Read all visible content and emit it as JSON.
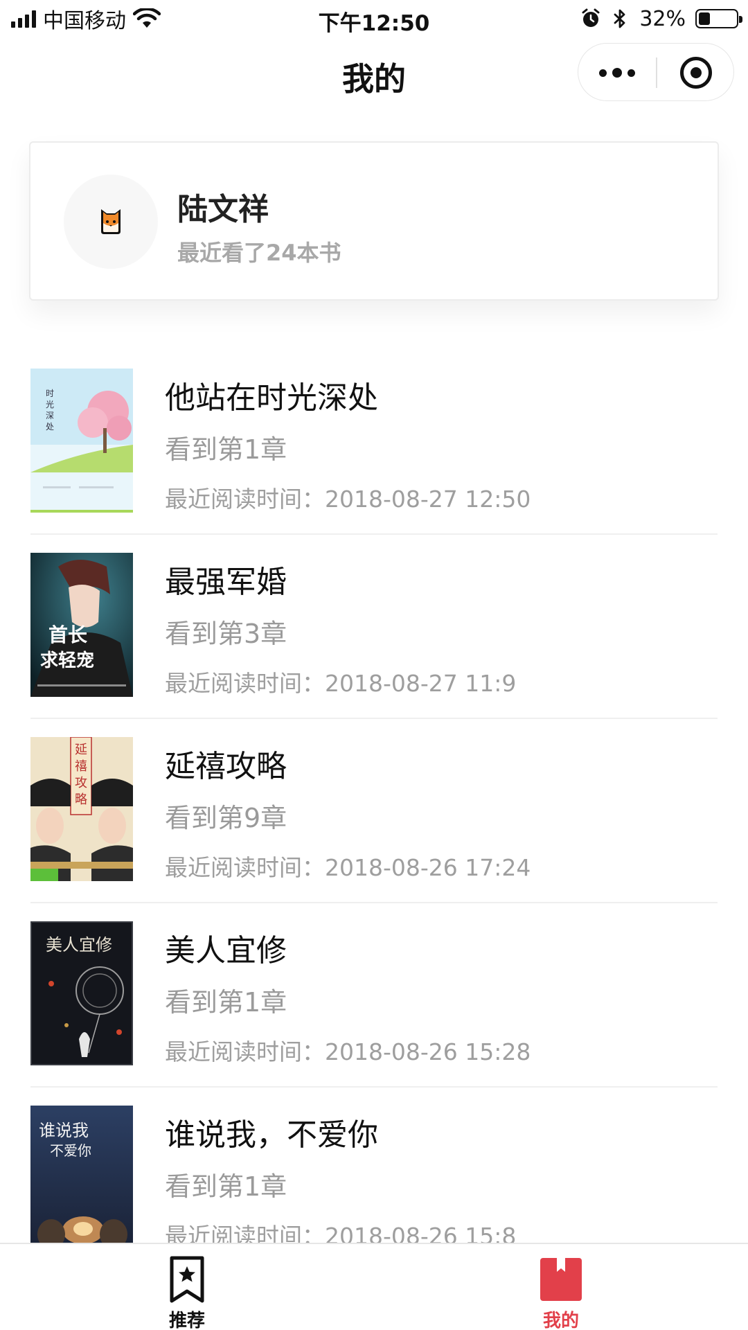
{
  "status_bar": {
    "carrier": "中国移动",
    "time": "下午12:50",
    "battery_percent": "32%",
    "battery_level": 0.32,
    "icons": [
      "signal-icon",
      "wifi-icon",
      "alarm-icon",
      "bluetooth-icon",
      "battery-icon"
    ]
  },
  "nav": {
    "title": "我的"
  },
  "profile": {
    "name": "陆文祥",
    "recent_count": "最近看了24本书"
  },
  "books": [
    {
      "title": "他站在时光深处",
      "chapter": "看到第1章",
      "last_read": "最近阅读时间：2018-08-27 12:50",
      "cover_text": [
        "时",
        "光",
        "深",
        "处"
      ]
    },
    {
      "title": "最强军婚",
      "chapter": "看到第3章",
      "last_read": "最近阅读时间：2018-08-27 11:9",
      "cover_text": [
        "首长",
        "求轻宠"
      ]
    },
    {
      "title": "延禧攻略",
      "chapter": "看到第9章",
      "last_read": "最近阅读时间：2018-08-26 17:24",
      "cover_text": [
        "延",
        "禧",
        "攻",
        "略"
      ]
    },
    {
      "title": "美人宜修",
      "chapter": "看到第1章",
      "last_read": "最近阅读时间：2018-08-26 15:28",
      "cover_text": [
        "美人宜修"
      ]
    },
    {
      "title": "谁说我，不爱你",
      "chapter": "看到第1章",
      "last_read": "最近阅读时间：2018-08-26 15:8",
      "cover_text": [
        "谁说我",
        "不爱你"
      ]
    }
  ],
  "tabs": [
    {
      "label": "推荐",
      "icon": "bookmark-star-icon",
      "active": false
    },
    {
      "label": "我的",
      "icon": "book-icon",
      "active": true
    }
  ],
  "colors": {
    "accent": "#e2404a",
    "text_primary": "#111111",
    "text_secondary": "#9a9a9a",
    "divider": "#efefef"
  }
}
